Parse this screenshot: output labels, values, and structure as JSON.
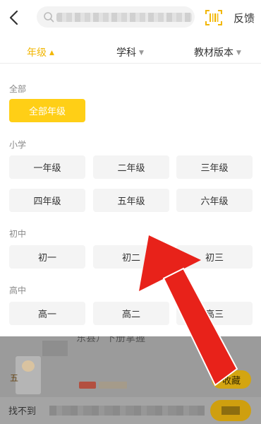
{
  "header": {
    "feedback_label": "反馈",
    "icons": [
      "back-icon",
      "search-icon",
      "scan-icon"
    ]
  },
  "filters": [
    {
      "label": "年级",
      "active": true
    },
    {
      "label": "学科",
      "active": false
    },
    {
      "label": "教材版本",
      "active": false
    }
  ],
  "sections": {
    "all": {
      "title": "全部",
      "chip": "全部年级"
    },
    "primary": {
      "title": "小学",
      "chips": [
        "一年级",
        "二年级",
        "三年级",
        "四年级",
        "五年级",
        "六年级"
      ]
    },
    "junior": {
      "title": "初中",
      "chips": [
        "初一",
        "初二",
        "初三"
      ]
    },
    "senior": {
      "title": "高中",
      "chips": [
        "高一",
        "高二",
        "高三"
      ]
    }
  },
  "background": {
    "title_fragment": "东县）下册掌握",
    "avatar_char": "五",
    "collect_label": "收藏",
    "bottom_text": "找不到"
  },
  "colors": {
    "accent": "#ffcf16",
    "accent_text": "#f2b705",
    "annotation_arrow": "#e8221a"
  }
}
